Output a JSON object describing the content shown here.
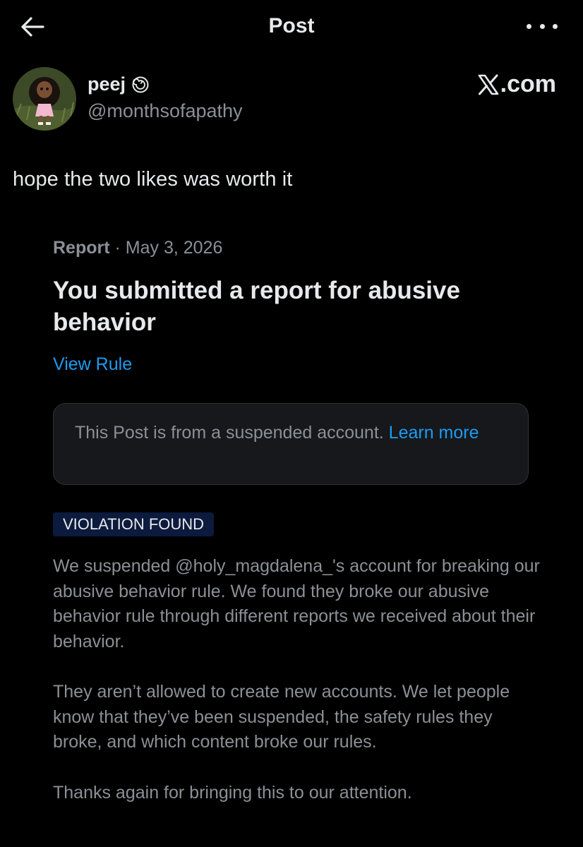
{
  "header": {
    "title": "Post",
    "back_icon": "arrow-left-icon",
    "more_icon": "more-horizontal-icon"
  },
  "author": {
    "display_name": "peej",
    "name_icon": "swirl-icon",
    "handle": "@monthsofapathy",
    "avatar_icon": "doll-avatar"
  },
  "watermark": {
    "logo": "x-logo-icon",
    "suffix": ".com"
  },
  "post": {
    "text": "hope the two likes was worth it"
  },
  "report": {
    "label": "Report",
    "separator": " · ",
    "date": "May 3, 2026",
    "title": "You submitted a report for abusive behavior",
    "view_rule": "View Rule",
    "notice_text": "This Post is from a suspended account. ",
    "notice_link": "Learn more",
    "badge": "VIOLATION FOUND",
    "paragraph_1": "We suspended @holy_magdalena_'s account for breaking our abusive behavior rule. We found they broke our abusive behavior rule through different reports we received about their behavior.",
    "paragraph_2": "They aren’t allowed to create new accounts. We let people know that they’ve been suspended, the safety rules they broke, and which content broke our rules.",
    "paragraph_3": "Thanks again for bringing this to our attention."
  },
  "colors": {
    "background": "#000000",
    "primary_text": "#e7e9ea",
    "secondary_text": "#8b9096",
    "link": "#1d9bf0",
    "badge_bg": "#0c1a3d",
    "notice_bg": "#16181c"
  }
}
